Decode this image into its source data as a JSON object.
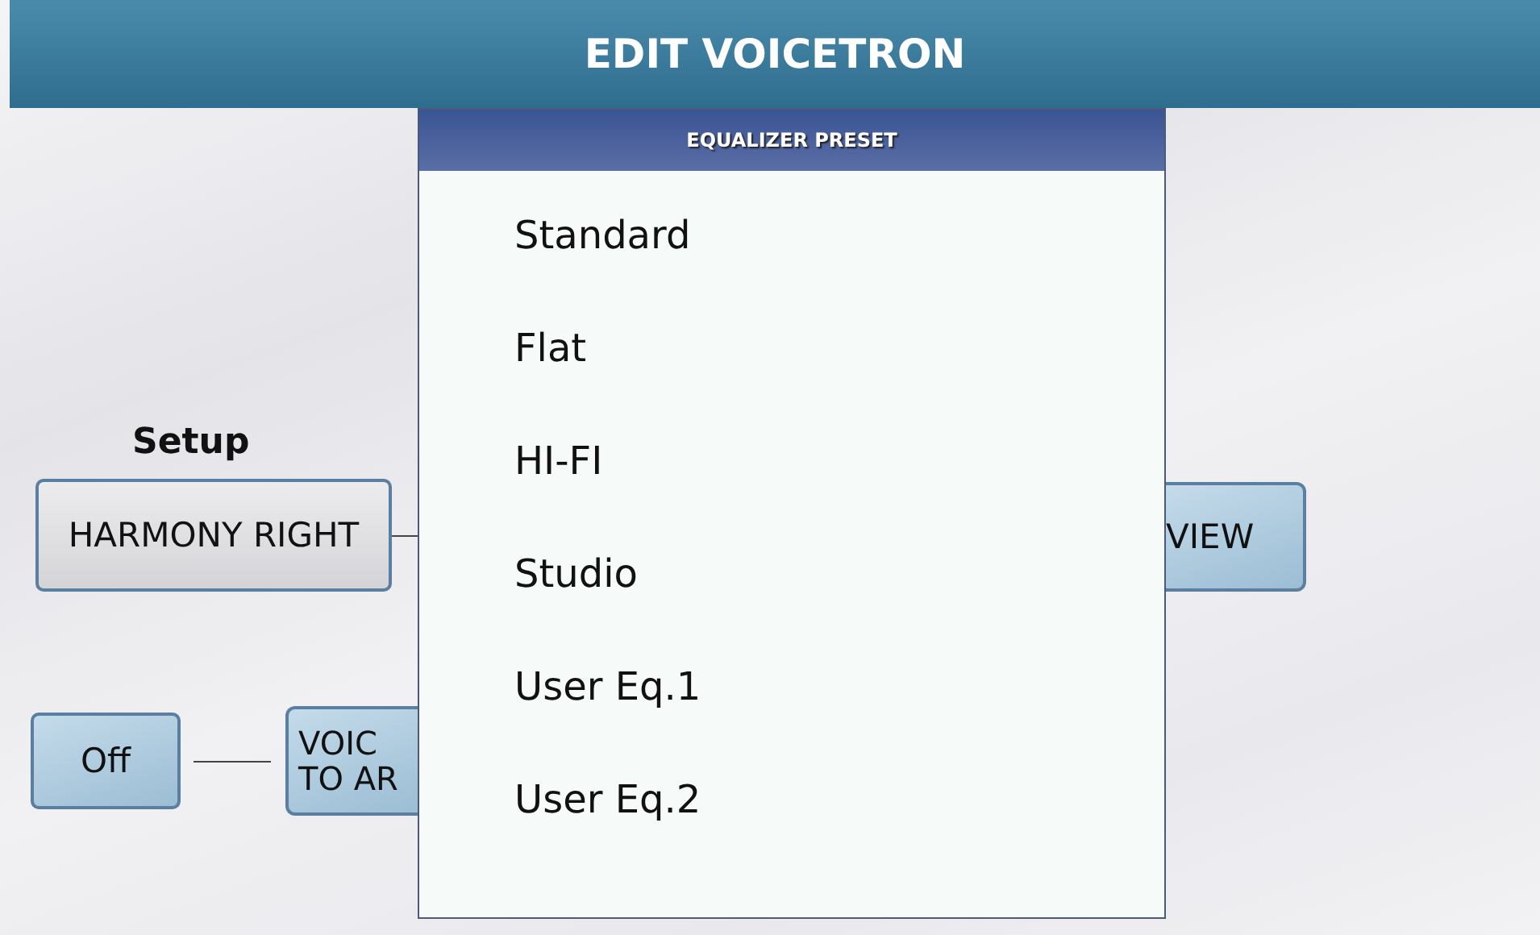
{
  "header": {
    "title": "EDIT VOICETRON"
  },
  "setup": {
    "label": "Setup",
    "button": "HARMONY RIGHT"
  },
  "off_button": "Off",
  "voice_button": {
    "lines": [
      "VOIC",
      "TO AR"
    ]
  },
  "view_button": "VIEW",
  "popup": {
    "title": "EQUALIZER PRESET",
    "items": [
      "Standard",
      "Flat",
      "HI-FI",
      "Studio",
      "User Eq.1",
      "User Eq.2"
    ]
  }
}
